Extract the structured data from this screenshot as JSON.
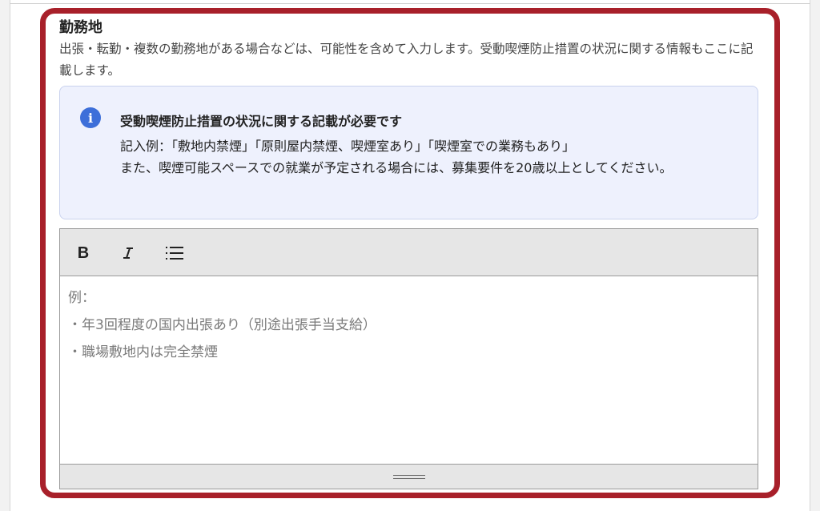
{
  "field": {
    "title": "勤務地",
    "description": "出張・転勤・複数の勤務地がある場合などは、可能性を含めて入力します。受動喫煙防止措置の状況に関する情報もここに記載します。"
  },
  "notice": {
    "icon": "info-icon",
    "heading": "受動喫煙防止措置の状況に関する記載が必要です",
    "example": "記入例：「敷地内禁煙」「原則屋内禁煙、喫煙室あり」「喫煙室での業務もあり」",
    "condition": "また、喫煙可能スペースでの就業が予定される場合には、募集要件を20歳以上としてください。",
    "accent_color": "#3d6fd9"
  },
  "editor": {
    "toolbar": {
      "bold_label": "B",
      "italic_icon": "italic-icon",
      "list_icon": "bulleted-list-icon"
    },
    "placeholder": "例：\n・年3回程度の国内出張あり（別途出張手当支給）\n・職場敷地内は完全禁煙"
  },
  "highlight_color": "#a8202a"
}
